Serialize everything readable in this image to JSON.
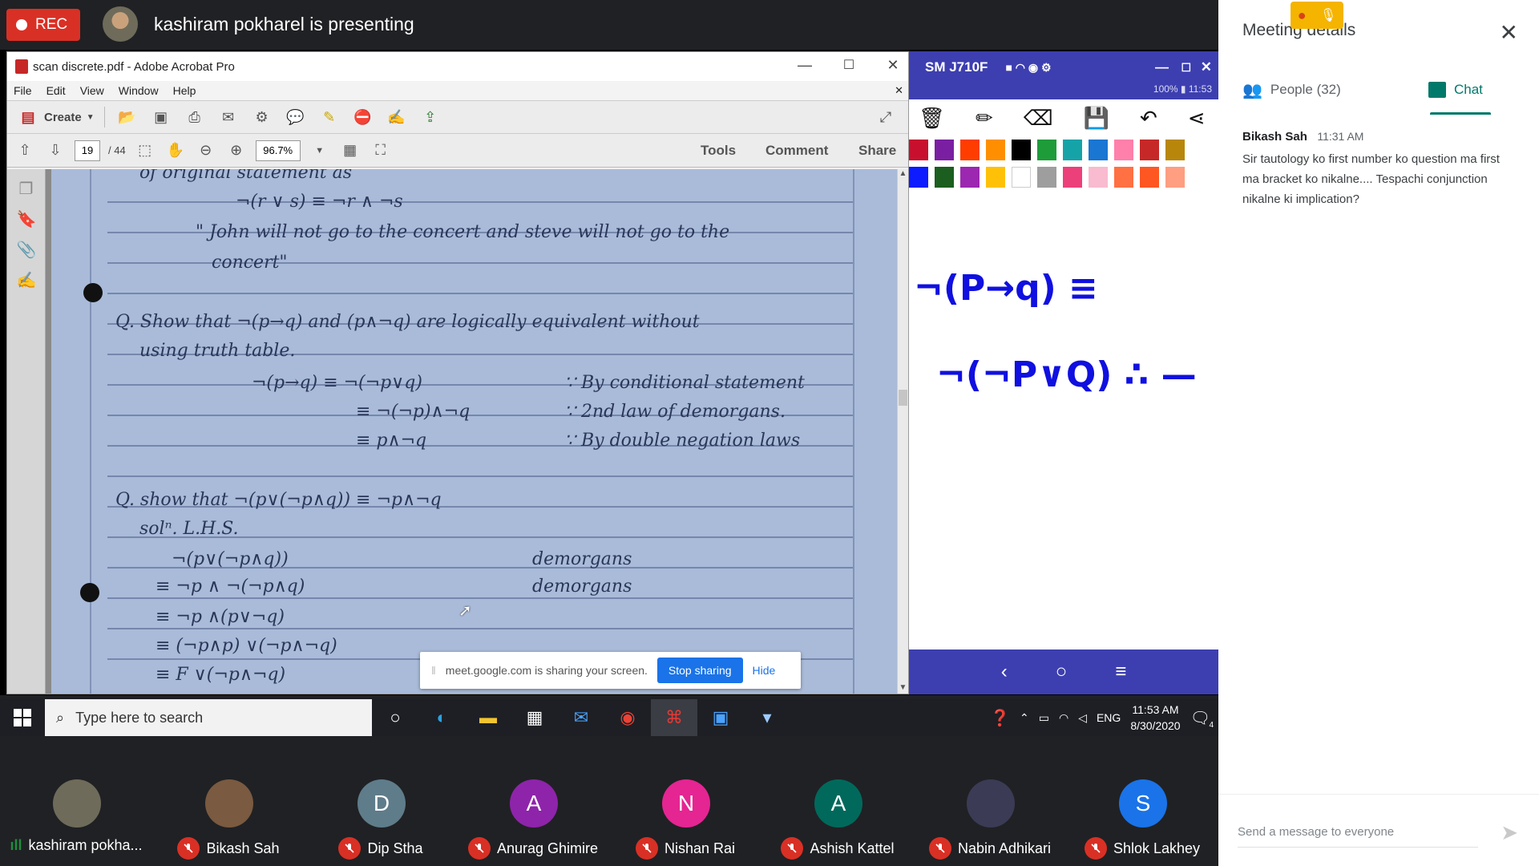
{
  "topbar": {
    "rec_label": "REC",
    "presenter_text": "kashiram pokharel is presenting"
  },
  "acrobat": {
    "title": "scan discrete.pdf - Adobe Acrobat Pro",
    "menu": [
      "File",
      "Edit",
      "View",
      "Window",
      "Help"
    ],
    "create_label": "Create",
    "page_current": "19",
    "page_total": "/ 44",
    "zoom": "96.7%",
    "tools_label": "Tools",
    "comment_label": "Comment",
    "share_label": "Share"
  },
  "notes": {
    "line1": "of original statement as",
    "line2": "¬(r ∨ s) ≡ ¬r ∧ ¬s",
    "line3": "\" John will not go to the concert and steve will not go to the",
    "line4": "concert\"",
    "line5": "Q. Show that ¬(p→q) and (p∧¬q) are logically equivalent without",
    "line6": "using truth table.",
    "line7a": "¬(p→q) ≡ ¬(¬p∨q)",
    "line7b": "∵ By conditional statement",
    "line8a": "≡ ¬(¬p)∧¬q",
    "line8b": "∵ 2nd law of demorgans.",
    "line9a": "≡ p∧¬q",
    "line9b": "∵ By double negation laws",
    "line10": "Q. show that ¬(p∨(¬p∧q)) ≡ ¬p∧¬q",
    "line11": "solⁿ. L.H.S.",
    "line12a": "¬(p∨(¬p∧q))",
    "line12b": "demorgans",
    "line13a": "≡ ¬p ∧ ¬(¬p∧q)",
    "line13b": "demorgans",
    "line14": "≡ ¬p ∧(p∨¬q)",
    "line15": "≡ (¬p∧p) ∨(¬p∧¬q)",
    "line16": "≡   F  ∨(¬p∧¬q)"
  },
  "share_bar": {
    "message": "meet.google.com is sharing your screen.",
    "stop": "Stop sharing",
    "hide": "Hide"
  },
  "phone": {
    "title": "SM J710F",
    "status": "100% ▮ 11:53",
    "swatches_row1": [
      "#c8102e",
      "#7b1fa2",
      "#ff3d00",
      "#ff8f00",
      "#000000",
      "#1e9c3a",
      "#16a3a8",
      "#1976d2",
      "#ff80ab",
      "#c62828",
      "#b8860b"
    ],
    "swatches_row2": [
      "#0d1bff",
      "#1b5e20",
      "#9c27b0",
      "#ffc107",
      "#ffffff",
      "#9e9e9e",
      "#ec407a",
      "#f8bbd0",
      "#ff7043",
      "#ff5722",
      "#ff9e80"
    ],
    "ink1": "¬(P→q) ≡",
    "ink2": "¬(¬P∨Q) ∴ —",
    "ink_color": "#1010e0"
  },
  "taskbar": {
    "search_placeholder": "Type here to search",
    "lang": "ENG",
    "time": "11:53 AM",
    "date": "8/30/2020",
    "notif_count": "4"
  },
  "participants": [
    {
      "name": "kashiram pokha...",
      "initial": "",
      "color": "#6f6b5a",
      "speaking": true
    },
    {
      "name": "Bikash Sah",
      "initial": "",
      "color": "#7a5a40",
      "speaking": false
    },
    {
      "name": "Dip Stha",
      "initial": "D",
      "color": "#5f7c8a",
      "speaking": false
    },
    {
      "name": "Anurag Ghimire",
      "initial": "A",
      "color": "#8e24aa",
      "speaking": false
    },
    {
      "name": "Nishan Rai",
      "initial": "N",
      "color": "#e52592",
      "speaking": false
    },
    {
      "name": "Ashish Kattel",
      "initial": "A",
      "color": "#00695c",
      "speaking": false
    },
    {
      "name": "Nabin Adhikari",
      "initial": "",
      "color": "#3b3b55",
      "speaking": false
    },
    {
      "name": "Shlok Lakhey",
      "initial": "S",
      "color": "#1a73e8",
      "speaking": false
    }
  ],
  "side": {
    "title": "Meeting details",
    "people_tab": "People (32)",
    "chat_tab": "Chat",
    "accent": "#00796b",
    "message": {
      "sender": "Bikash Sah",
      "time": "11:31 AM",
      "text": "Sir tautology ko first number ko question ma first ma bracket ko nikalne.... Tespachi conjunction nikalne ki implication?"
    },
    "send_placeholder": "Send a message to everyone"
  }
}
